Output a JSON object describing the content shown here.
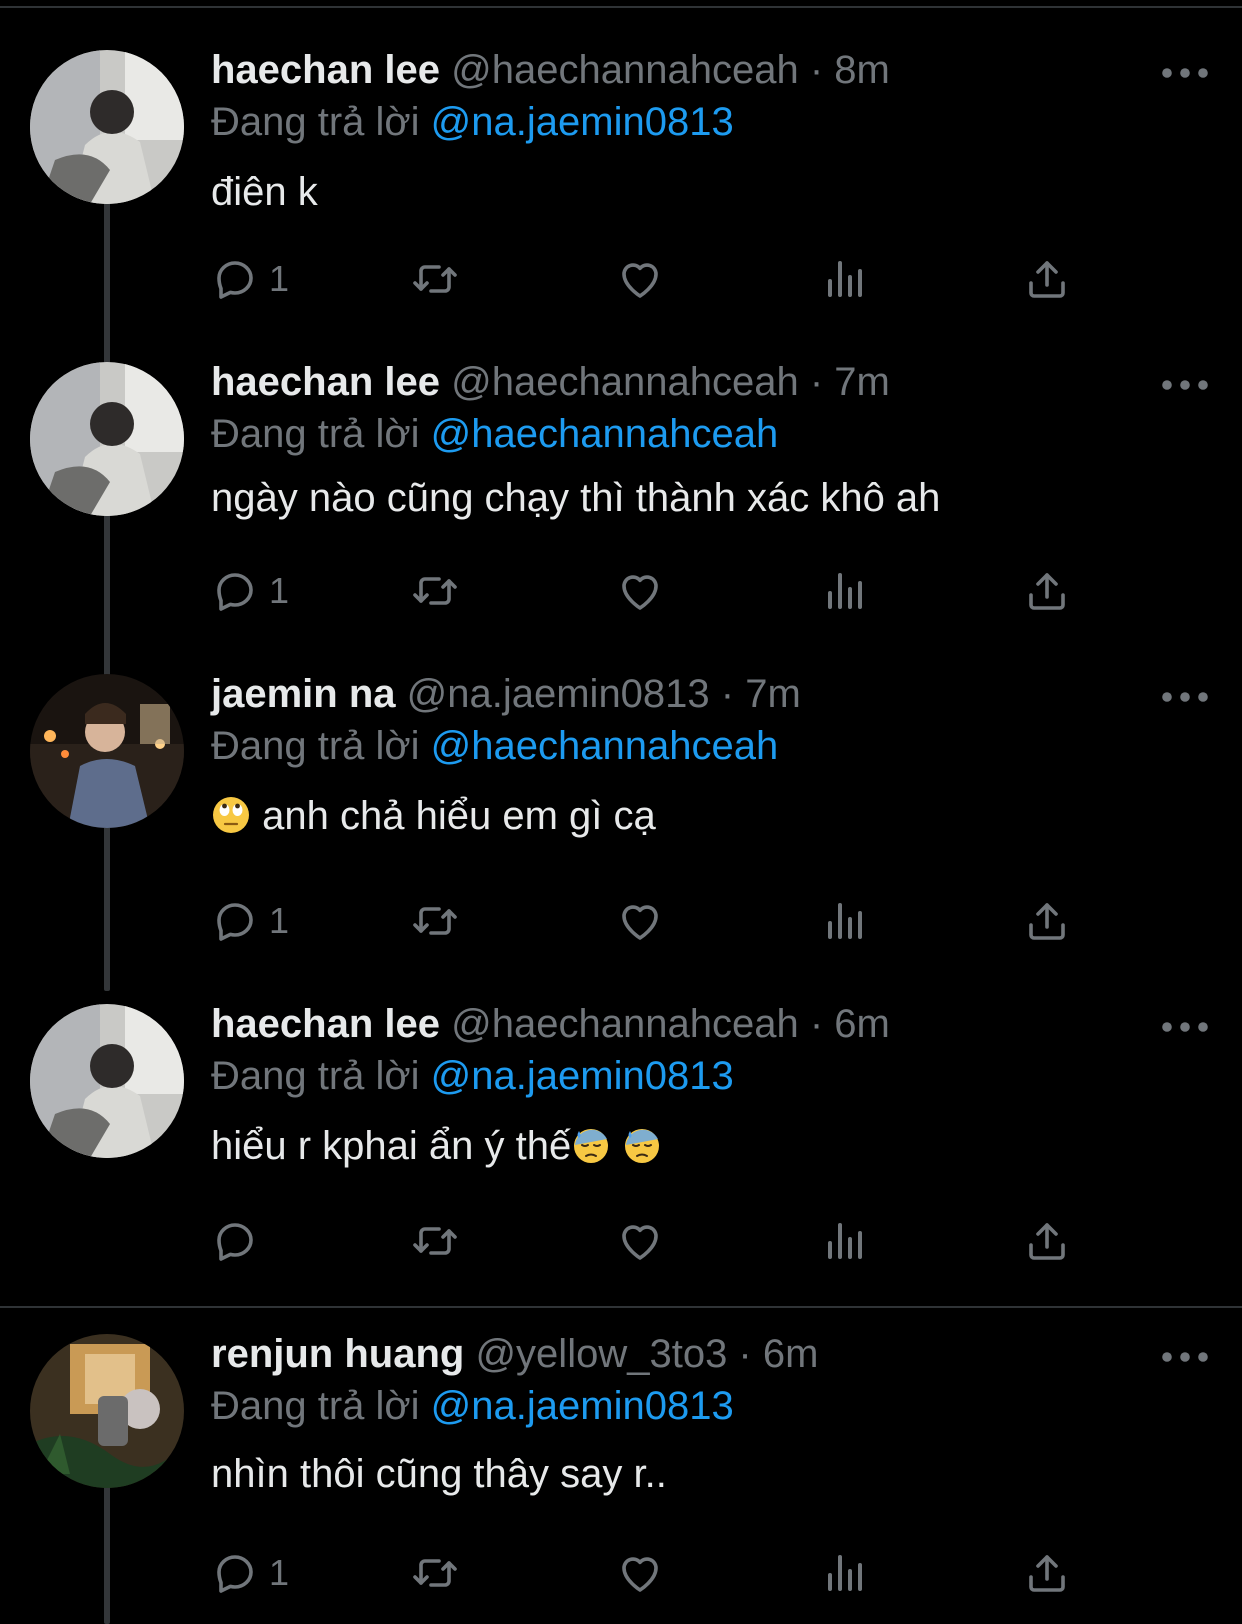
{
  "reply_prefix": "Đang trả lời",
  "tweets": [
    {
      "name": "haechan lee",
      "meta": "@haechannahceah · 8m",
      "mention": "@na.jaemin0813",
      "text": "điên k",
      "reply_count": "1"
    },
    {
      "name": "haechan lee",
      "meta": "@haechannahceah · 7m",
      "mention": "@haechannahceah",
      "text": "ngày nào cũng chạy thì thành xác khô ah",
      "reply_count": "1"
    },
    {
      "name": "jaemin na",
      "meta": "@na.jaemin0813 · 7m",
      "mention": "@haechannahceah",
      "text": "anh chả hiểu em gì cạ",
      "text_emoji": "face-with-rolling-eyes",
      "reply_count": "1"
    },
    {
      "name": "haechan lee",
      "meta": "@haechannahceah · 6m",
      "mention": "@na.jaemin0813",
      "text": "hiểu r kphai ẩn ý thế",
      "text_emoji": "downcast-face-with-sweat",
      "reply_count": ""
    },
    {
      "name": "renjun huang",
      "meta": "@yellow_3to3 · 6m",
      "mention": "@na.jaemin0813",
      "text": "nhìn thôi cũng thây say r..",
      "reply_count": "1"
    }
  ],
  "colors": {
    "background": "#000000",
    "text": "#e7e9ea",
    "secondary": "#71767b",
    "accent": "#1d9bf0"
  },
  "icons": [
    "reply-icon",
    "retweet-icon",
    "like-icon",
    "views-icon",
    "share-icon",
    "more-icon"
  ]
}
